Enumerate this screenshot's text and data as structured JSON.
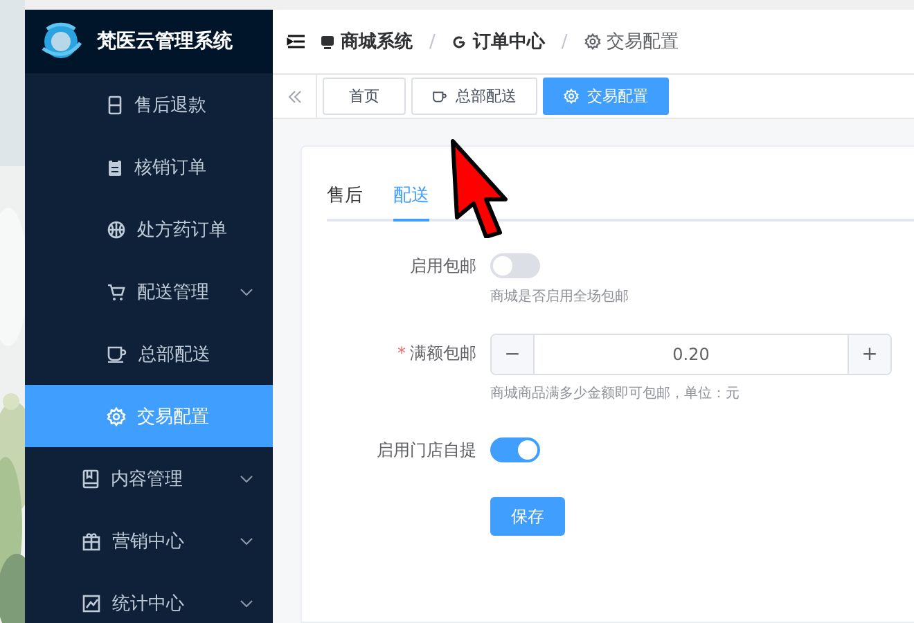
{
  "app": {
    "title": "梵医云管理系统"
  },
  "sidebar": {
    "items": [
      {
        "label": "售后退款",
        "kind": "sub",
        "selected": false
      },
      {
        "label": "核销订单",
        "kind": "sub",
        "selected": false
      },
      {
        "label": "处方药订单",
        "kind": "sub",
        "selected": false
      },
      {
        "label": "配送管理",
        "kind": "subgroup",
        "selected": false
      },
      {
        "label": "总部配送",
        "kind": "sub",
        "selected": false
      },
      {
        "label": "交易配置",
        "kind": "sub",
        "selected": true
      },
      {
        "label": "内容管理",
        "kind": "group",
        "selected": false
      },
      {
        "label": "营销中心",
        "kind": "group",
        "selected": false
      },
      {
        "label": "统计中心",
        "kind": "group",
        "selected": false
      }
    ]
  },
  "breadcrumb": [
    {
      "label": "商城系统"
    },
    {
      "separator": "/",
      "label": "订单中心"
    },
    {
      "separator": "/",
      "label": "交易配置"
    }
  ],
  "tabs": [
    {
      "label": "首页",
      "selected": false
    },
    {
      "label": "总部配送",
      "selected": false
    },
    {
      "label": "交易配置",
      "selected": true
    }
  ],
  "form_tabs": [
    {
      "label": "售后",
      "selected": false
    },
    {
      "label": "配送",
      "selected": true
    }
  ],
  "fields": [
    {
      "kind": "switch",
      "label": "启用包邮",
      "on": false,
      "hint": "商城是否启用全场包邮"
    },
    {
      "kind": "number",
      "label": "满额包邮",
      "required_mark": "*",
      "value": "0.20",
      "minus": "−",
      "plus": "+",
      "hint": "商城商品满多少金额即可包邮，单位：元"
    },
    {
      "kind": "switch",
      "label": "启用门店自提",
      "on": true
    }
  ],
  "save_button": "保存"
}
